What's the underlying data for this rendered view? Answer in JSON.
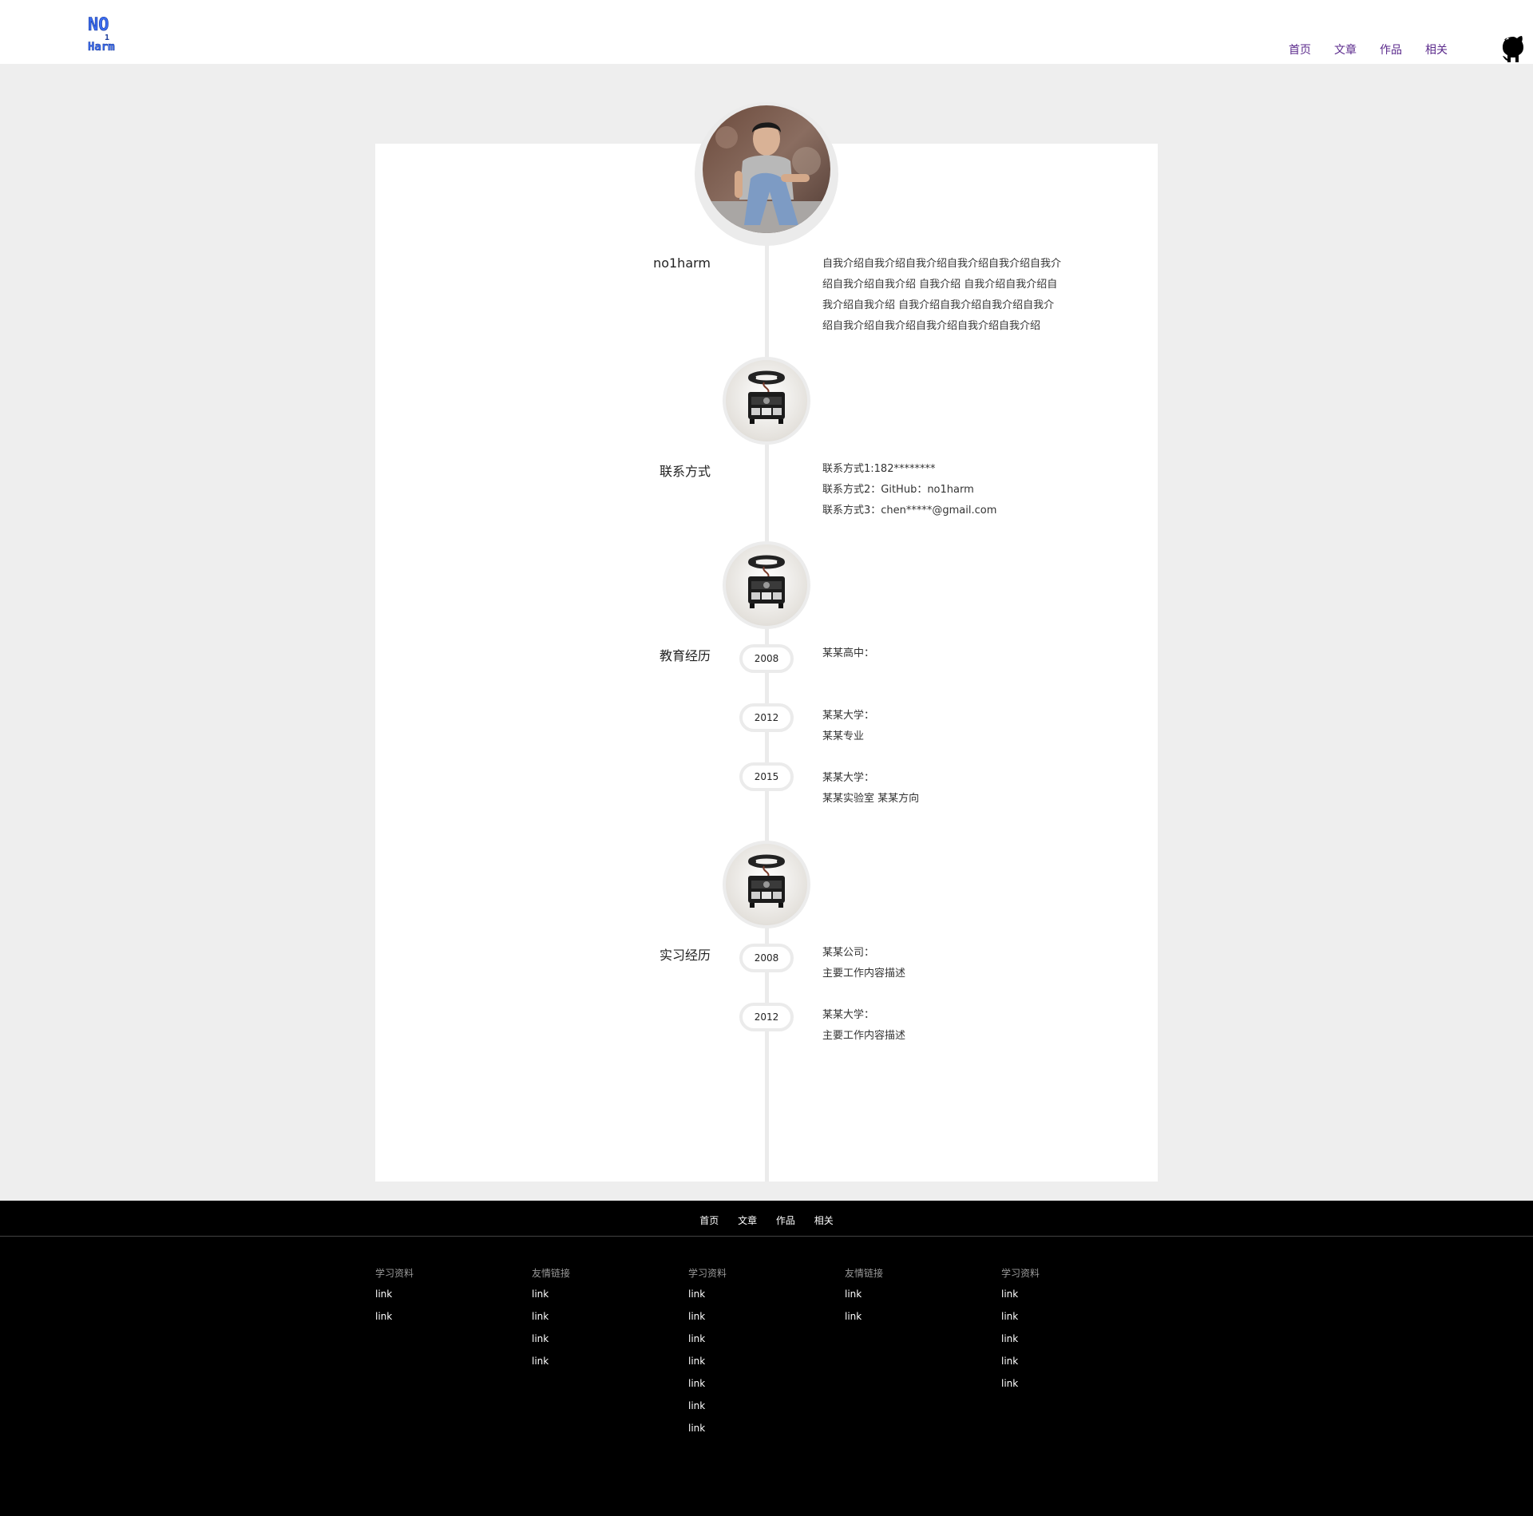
{
  "header": {
    "logo_text": [
      "NO",
      "1",
      "Harm"
    ],
    "nav": [
      "首页",
      "文章",
      "作品",
      "相关"
    ]
  },
  "profile": {
    "name": "no1harm",
    "intro": [
      "自我介绍自我介绍自我介绍自我介绍自我介绍自我介",
      "绍自我介绍自我介绍 自我介绍 自我介绍自我介绍自",
      "我介绍自我介绍 自我介绍自我介绍自我介绍自我介",
      "绍自我介绍自我介绍自我介绍自我介绍自我介绍"
    ]
  },
  "contact": {
    "title": "联系方式",
    "lines": [
      "联系方式1:182********",
      "联系方式2：GitHub：no1harm",
      "联系方式3：chen*****@gmail.com"
    ]
  },
  "education": {
    "title": "教育经历",
    "items": [
      {
        "year": "2008",
        "lines": [
          "某某高中："
        ]
      },
      {
        "year": "2012",
        "lines": [
          "某某大学：",
          "某某专业"
        ]
      },
      {
        "year": "2015",
        "lines": [
          "某某大学：",
          "某某实验室 某某方向"
        ]
      }
    ]
  },
  "internship": {
    "title": "实习经历",
    "items": [
      {
        "year": "2008",
        "lines": [
          "某某公司：",
          "主要工作内容描述"
        ]
      },
      {
        "year": "2012",
        "lines": [
          "某某大学：",
          "主要工作内容描述"
        ]
      }
    ]
  },
  "footer": {
    "nav": [
      "首页",
      "文章",
      "作品",
      "相关"
    ],
    "columns": [
      {
        "heading": "学习资料",
        "links": [
          "link",
          "link"
        ]
      },
      {
        "heading": "友情链接",
        "links": [
          "link",
          "link",
          "link",
          "link"
        ]
      },
      {
        "heading": "学习资料",
        "links": [
          "link",
          "link",
          "link",
          "link",
          "link",
          "link",
          "link"
        ]
      },
      {
        "heading": "友情链接",
        "links": [
          "link",
          "link"
        ]
      },
      {
        "heading": "学习资料",
        "links": [
          "link",
          "link",
          "link",
          "link",
          "link"
        ]
      }
    ]
  }
}
